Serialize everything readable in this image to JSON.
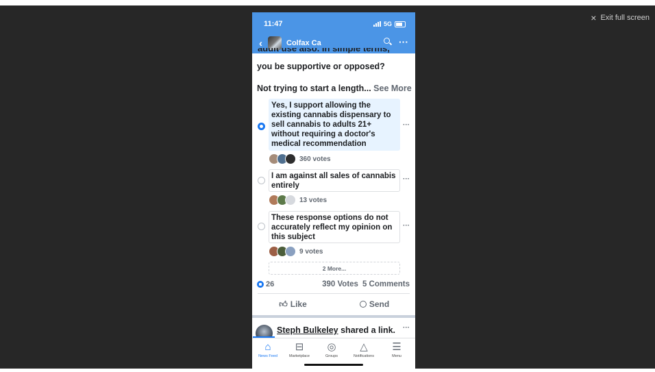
{
  "viewer": {
    "exit_label": "Exit full screen"
  },
  "status": {
    "time": "11:47",
    "network": "5G"
  },
  "header": {
    "group_name": "Colfax Ca"
  },
  "post": {
    "cut_off_line": "adult use also. In simple terms, would",
    "line1": "you be supportive or opposed?",
    "teaser": "Not trying to start a length...",
    "see_more": "See More"
  },
  "poll": {
    "options": [
      {
        "text": "Yes, I support allowing the existing cannabis dispensary to sell cannabis to adults 21+ without requiring a doctor's medical recommendation",
        "votes": "360 votes",
        "selected": true
      },
      {
        "text": "I am against all sales of cannabis entirely",
        "votes": "13 votes",
        "selected": false
      },
      {
        "text": "These response options do not accurately reflect my opinion on this subject",
        "votes": "9 votes",
        "selected": false
      }
    ],
    "more_label": "2 More..."
  },
  "footer": {
    "reaction_count": "26",
    "votes_total": "390 Votes",
    "comments": "5 Comments",
    "like_label": "Like",
    "send_label": "Send"
  },
  "next_post": {
    "author": "Steph Bulkeley",
    "action": "shared a link."
  },
  "tabs": [
    {
      "label": "News Feed",
      "icon": "home-icon",
      "active": true
    },
    {
      "label": "Marketplace",
      "icon": "marketplace-icon",
      "active": false
    },
    {
      "label": "Groups",
      "icon": "groups-icon",
      "active": false
    },
    {
      "label": "Notifications",
      "icon": "bell-icon",
      "active": false
    },
    {
      "label": "Menu",
      "icon": "menu-icon",
      "active": false
    }
  ],
  "colors": {
    "brand": "#4b95e6",
    "accent": "#1877f2",
    "selected_option": "#e7f3ff",
    "background": "#272727"
  }
}
